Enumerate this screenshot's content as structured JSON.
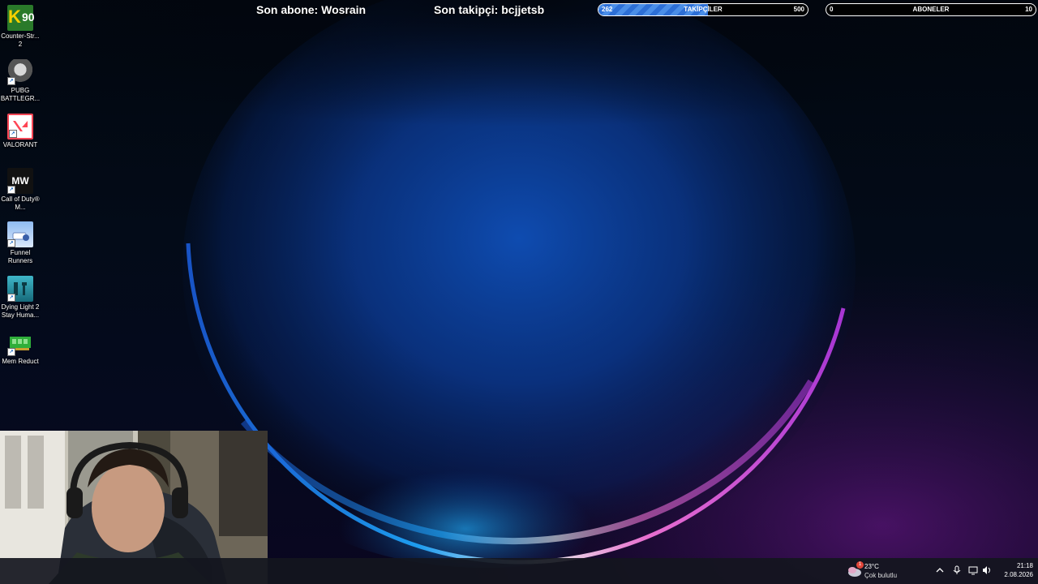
{
  "desktop_icons": [
    {
      "id": "cs2",
      "label": "Counter-Str... 2",
      "badge_text": "90"
    },
    {
      "id": "pubg",
      "label": "PUBG BATTLEGR..."
    },
    {
      "id": "valorant",
      "label": "VALORANT"
    },
    {
      "id": "cod",
      "label": "Call of Duty® M...",
      "badge_text": "MW"
    },
    {
      "id": "funnel",
      "label": "Funnel Runners"
    },
    {
      "id": "dying-light",
      "label": "Dying Light 2 Stay Huma..."
    },
    {
      "id": "mem-reduct",
      "label": "Mem Reduct"
    }
  ],
  "overlay": {
    "last_sub": "Son abone: Wosrain",
    "last_follower": "Son takipçi: bcjjetsb"
  },
  "goals": {
    "followers": {
      "label": "TAKİPÇİLER",
      "current": "262",
      "target": "500",
      "progress": 0.524
    },
    "subscribers": {
      "label": "ABONELER",
      "current": "0",
      "target": "10",
      "progress": 0.0
    }
  },
  "taskbar": {
    "weather": {
      "temp": "23°C",
      "desc": "Çok bulutlu",
      "badge": "1"
    },
    "time": "21:18",
    "date": "2.08.2026"
  },
  "colors": {
    "goal_fill": "#3f84e5",
    "taskbar_bg": "#14161e",
    "wallpaper_glow_blue": "#1a8ff0",
    "wallpaper_glow_pink": "#d03cd8"
  }
}
